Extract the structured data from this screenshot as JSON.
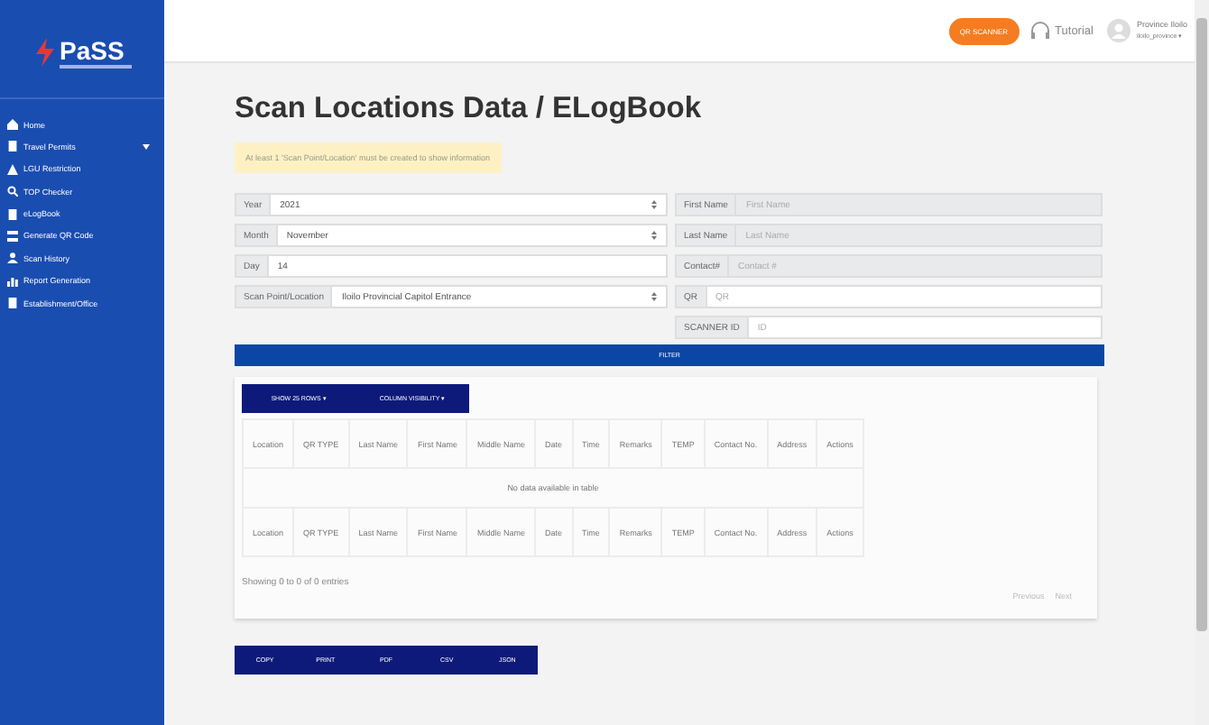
{
  "logo": {
    "name": "PaSS"
  },
  "sidebar": {
    "items": [
      {
        "label": "Home",
        "caret": false
      },
      {
        "label": "Travel Permits",
        "caret": true
      },
      {
        "label": "LGU Restriction",
        "caret": false
      },
      {
        "label": "TOP Checker",
        "caret": false
      },
      {
        "label": "eLogBook",
        "caret": false
      },
      {
        "label": "Generate QR Code",
        "caret": false
      },
      {
        "label": "Scan History",
        "caret": false
      },
      {
        "label": "Report Generation",
        "caret": false
      },
      {
        "label": "Establishment/Office",
        "caret": false
      }
    ]
  },
  "header": {
    "scanner_button": "QR SCANNER",
    "tutorial": "Tutorial",
    "user_name": "Province Iloilo",
    "user_handle": "iloilo_province ▾"
  },
  "page": {
    "title": "Scan Locations Data / ELogBook",
    "notice": "At least 1 'Scan Point/Location' must be created to show information"
  },
  "left_fields": [
    {
      "label": "Year",
      "value": "2021",
      "kind": "select"
    },
    {
      "label": "Month",
      "value": "November",
      "kind": "select"
    },
    {
      "label": "Day",
      "value": "14",
      "kind": "input"
    },
    {
      "label": "Scan Point/Location",
      "value": "Iloilo Provincial Capitol Entrance",
      "kind": "select"
    }
  ],
  "right_fields": [
    {
      "label": "First Name",
      "placeholder": "First Name",
      "disabled": true
    },
    {
      "label": "Last Name",
      "placeholder": "Last Name",
      "disabled": true
    },
    {
      "label": "Contact#",
      "placeholder": "Contact #",
      "disabled": true
    },
    {
      "label": "QR",
      "placeholder": "QR",
      "disabled": false
    },
    {
      "label": "SCANNER ID",
      "placeholder": "ID",
      "disabled": false
    }
  ],
  "filter_button": "FILTER",
  "table": {
    "toolbar": [
      "SHOW 25 ROWS ▾",
      "COLUMN VISIBILITY ▾"
    ],
    "columns": [
      "Location",
      "QR TYPE",
      "Last Name",
      "First Name",
      "Middle Name",
      "Date",
      "Time",
      "Remarks",
      "TEMP",
      "Contact No.",
      "Address",
      "Actions"
    ],
    "empty_message": "No data available in table",
    "footer_columns": [
      "Location",
      "QR TYPE",
      "Last Name",
      "First Name",
      "Middle Name",
      "Date",
      "Time",
      "Remarks",
      "TEMP",
      "Contact No.",
      "Address",
      "Actions"
    ],
    "info": "Showing 0 to 0 of 0 entries",
    "pagination": [
      "Previous",
      "Next"
    ]
  },
  "export_buttons": [
    "COPY",
    "PRINT",
    "PDF",
    "CSV",
    "JSON"
  ]
}
